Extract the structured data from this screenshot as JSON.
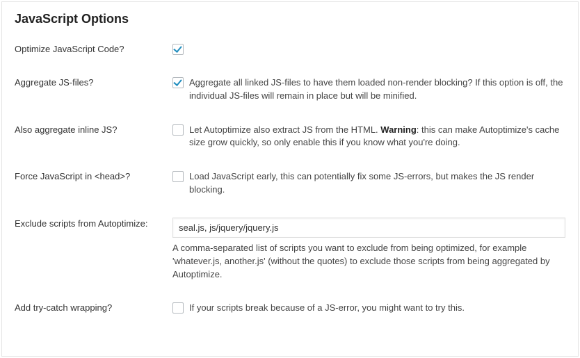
{
  "panel": {
    "title": "JavaScript Options"
  },
  "rows": {
    "optimize": {
      "label": "Optimize JavaScript Code?",
      "checked": true
    },
    "aggregate": {
      "label": "Aggregate JS-files?",
      "checked": true,
      "desc": "Aggregate all linked JS-files to have them loaded non-render blocking? If this option is off, the individual JS-files will remain in place but will be minified."
    },
    "inline": {
      "label": "Also aggregate inline JS?",
      "checked": false,
      "desc_prefix": "Let Autoptimize also extract JS from the HTML. ",
      "desc_bold": "Warning",
      "desc_suffix": ": this can make Autoptimize's cache size grow quickly, so only enable this if you know what you're doing."
    },
    "forcehead": {
      "label": "Force JavaScript in <head>?",
      "checked": false,
      "desc": "Load JavaScript early, this can potentially fix some JS-errors, but makes the JS render blocking."
    },
    "exclude": {
      "label": "Exclude scripts from Autoptimize:",
      "value": "seal.js, js/jquery/jquery.js",
      "help": "A comma-separated list of scripts you want to exclude from being optimized, for example 'whatever.js, another.js' (without the quotes) to exclude those scripts from being aggregated by Autoptimize."
    },
    "trycatch": {
      "label": "Add try-catch wrapping?",
      "checked": false,
      "desc": "If your scripts break because of a JS-error, you might want to try this."
    }
  }
}
